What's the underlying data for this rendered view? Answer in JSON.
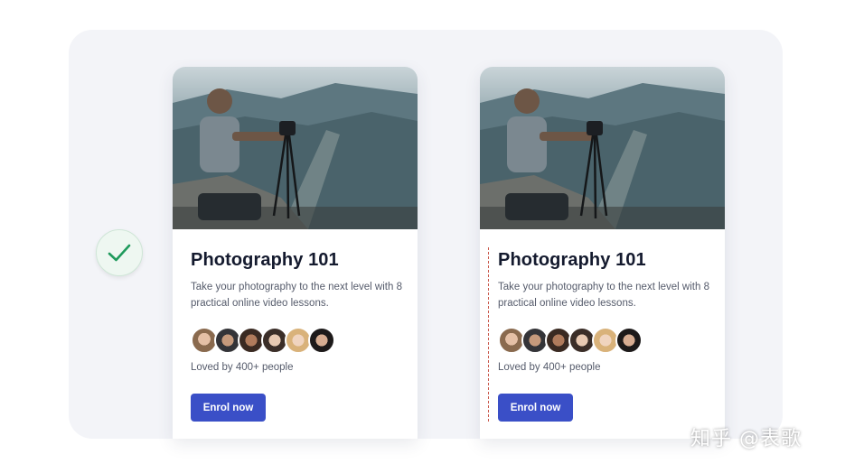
{
  "cards": [
    {
      "title": "Photography 101",
      "description": "Take your photography to the next level with 8 practical online video lessons.",
      "loved_text": "Loved by 400+ people",
      "button_label": "Enrol now",
      "avatar_count": 6
    },
    {
      "title": "Photography 101",
      "description": "Take your photography to the next level with 8 practical online video lessons.",
      "loved_text": "Loved by 400+ people",
      "button_label": "Enrol now",
      "avatar_count": 6
    }
  ],
  "badge_icon": "checkmark-icon",
  "watermark": "知乎 @表歌",
  "colors": {
    "accent": "#3a4fc7",
    "check": "#1f9a5c",
    "guide": "#c9574a",
    "panel": "#f3f4f8"
  }
}
